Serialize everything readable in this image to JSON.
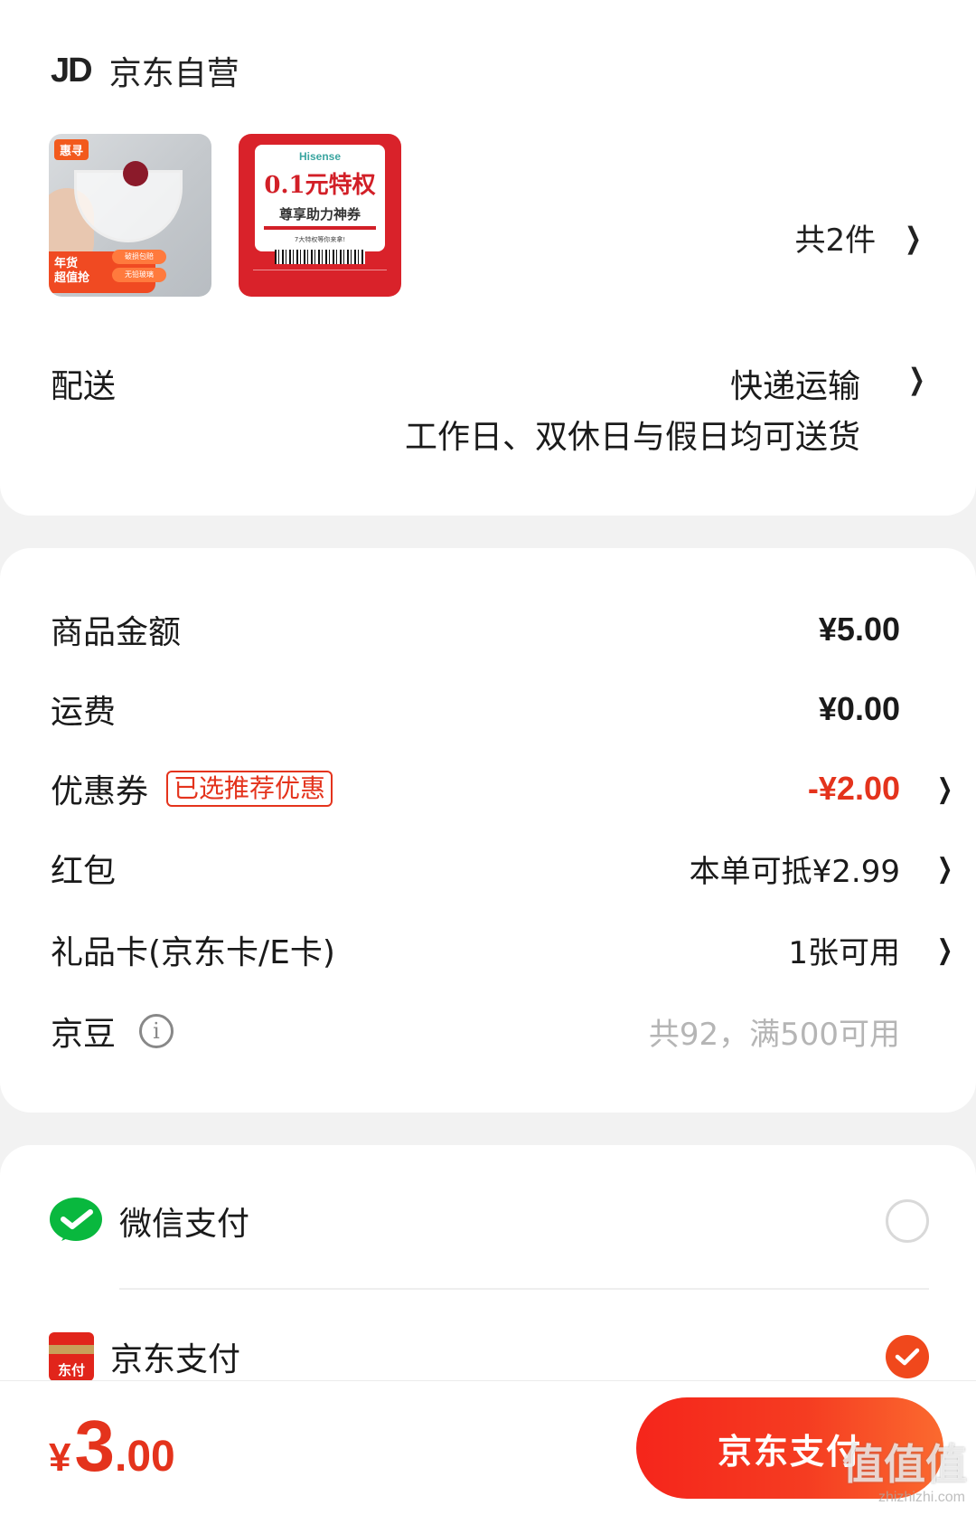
{
  "store": {
    "logo": "JD",
    "name": "京东自营"
  },
  "products": {
    "thumb1": {
      "tag": "惠寻",
      "promo_line1": "年货",
      "promo_line2": "超值抢",
      "chip1": "破损包赔",
      "chip2": "无铅玻璃"
    },
    "thumb2": {
      "brand": "Hisense",
      "value": "0.1元特权",
      "sub": "尊享助力神券",
      "note": "7大特权等你来拿!"
    },
    "count": "共2件"
  },
  "delivery": {
    "label": "配送",
    "method": "快递运输",
    "note": "工作日、双休日与假日均可送货"
  },
  "summary": {
    "goods": {
      "label": "商品金额",
      "value": "¥5.00"
    },
    "shipping": {
      "label": "运费",
      "value": "¥0.00"
    },
    "coupon": {
      "label": "优惠券",
      "badge": "已选推荐优惠",
      "value": "-¥2.00"
    },
    "redpacket": {
      "label": "红包",
      "value": "本单可抵¥2.99"
    },
    "giftcard": {
      "label": "礼品卡(京东卡/E卡)",
      "value": "1张可用"
    },
    "jingdou": {
      "label": "京豆",
      "value": "共92，满500可用"
    }
  },
  "payment": {
    "wechat": {
      "label": "微信支付",
      "selected": false
    },
    "jdpay": {
      "label": "京东支付",
      "icon_text": "东付",
      "selected": true
    }
  },
  "footer": {
    "total_yen": "¥",
    "total_int": "3",
    "total_dec": ".00",
    "pay_button": "京东支付",
    "watermark": "值值值",
    "watermark_site": "zhizhizhi.com"
  },
  "colors": {
    "accent": "#e4331c",
    "button": "#f5251b",
    "wechat": "#09b83e"
  }
}
